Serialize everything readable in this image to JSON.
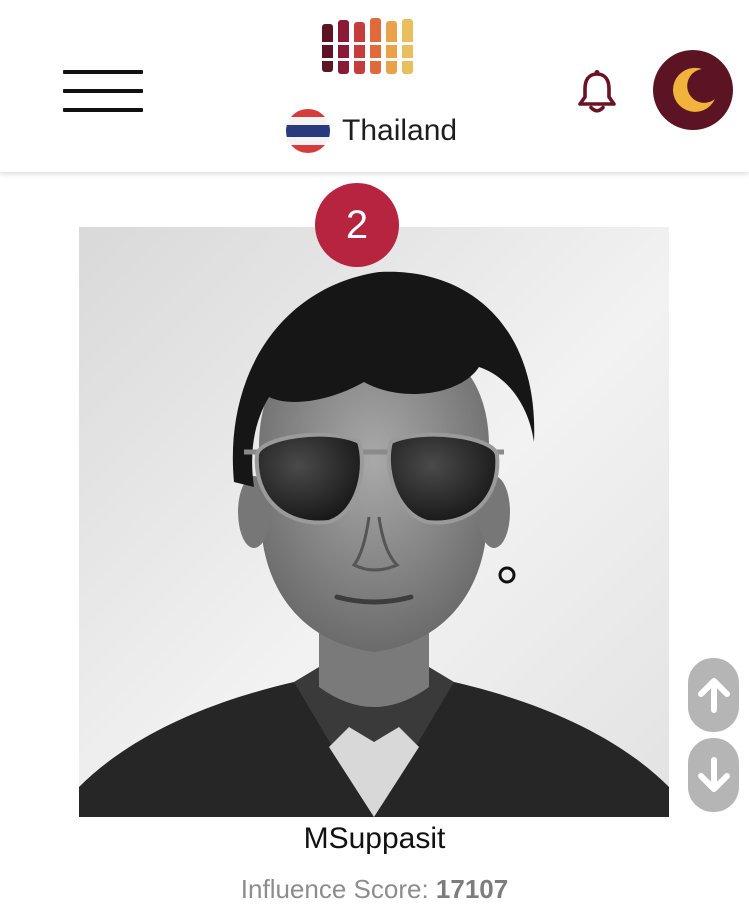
{
  "header": {
    "menu_icon": "hamburger-menu-icon",
    "logo_icon": "bar-logo-icon",
    "country": {
      "name": "Thailand",
      "flag_icon": "thailand-flag-icon"
    },
    "notification_icon": "bell-icon",
    "theme_icon": "moon-icon"
  },
  "profile": {
    "rank": "2",
    "name": "MSuppasit",
    "score_label": "Influence Score:",
    "score_value": "17107",
    "photo_icon": "profile-photo"
  },
  "scroll": {
    "up_icon": "arrow-up-icon",
    "down_icon": "arrow-down-icon"
  },
  "colors": {
    "brand_maroon": "#5c1425",
    "badge_red": "#b6243f",
    "moon_yellow": "#f2b33d",
    "logo_bars": [
      "#5c1425",
      "#8a1a35",
      "#c63b3b",
      "#e06b3a",
      "#eaa24a",
      "#e9be5c"
    ],
    "scroll_button_gray": "#b5b5b5"
  }
}
